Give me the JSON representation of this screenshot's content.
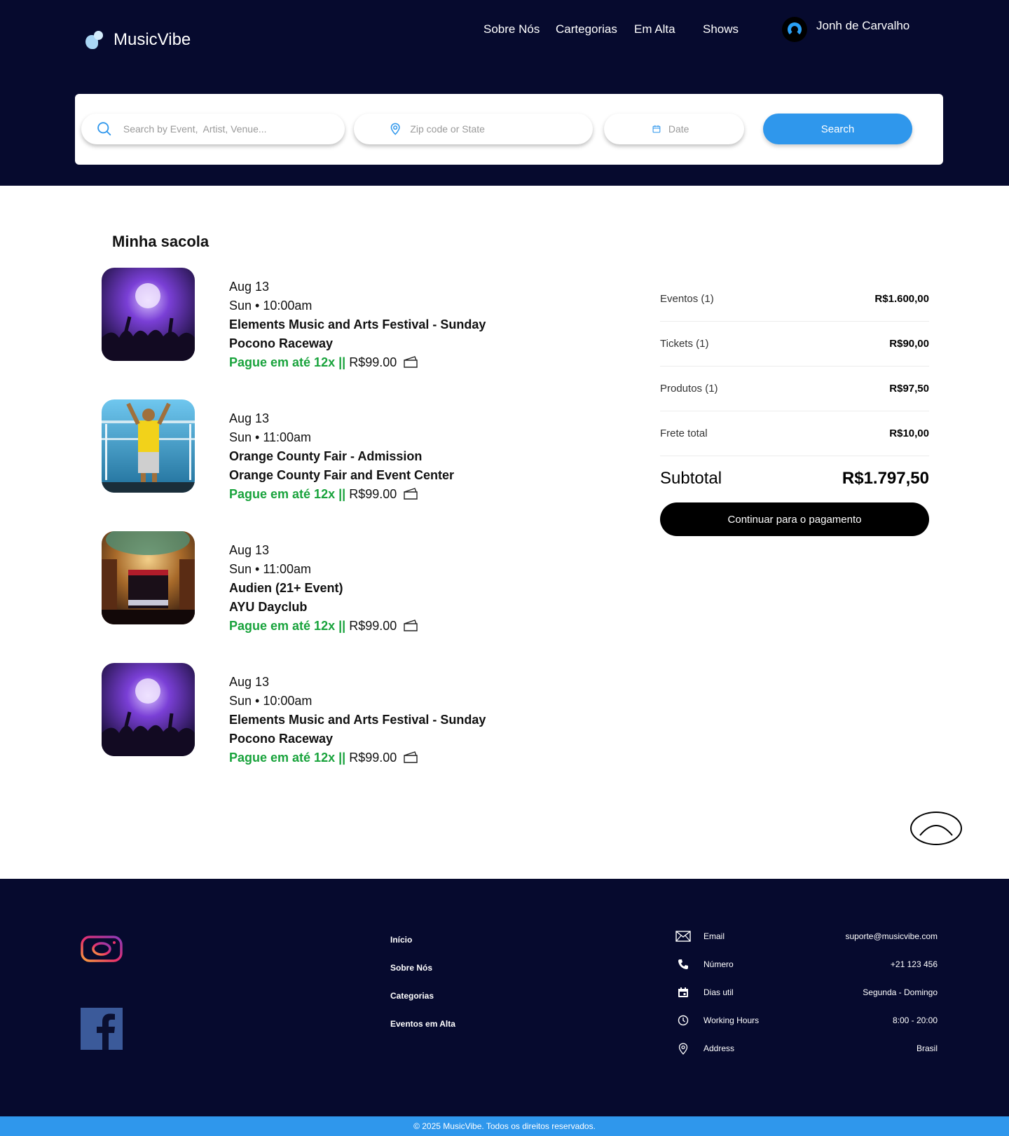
{
  "brand": {
    "name": "MusicVibe"
  },
  "nav": {
    "items": [
      {
        "label": "Sobre Nós"
      },
      {
        "label": "Cartegorias"
      },
      {
        "label": "Em Alta"
      },
      {
        "label": "Shows"
      }
    ],
    "user_name": "Jonh de Carvalho"
  },
  "search": {
    "query_placeholder": "Search by Event,  Artist, Venue...",
    "location_placeholder": "Zip code or State",
    "date_placeholder": "Date",
    "button_label": "Search"
  },
  "bag": {
    "title": "Minha sacola",
    "items": [
      {
        "date": "Aug 13",
        "time": "Sun • 10:00am",
        "event": "Elements Music and Arts Festival - Sunday",
        "venue": "Pocono Raceway",
        "installments": "Pague em até 12x",
        "separator": "||",
        "price": "R$99.00",
        "image": "concert-crowd-purple"
      },
      {
        "date": "Aug 13",
        "time": "Sun • 11:00am",
        "event": "Orange County Fair - Admission",
        "venue": "Orange County Fair and Event Center",
        "installments": "Pague em até 12x",
        "separator": "||",
        "price": "R$99.00",
        "image": "performer-stage-blue"
      },
      {
        "date": "Aug 13",
        "time": "Sun • 11:00am",
        "event": "Audien (21+ Event)",
        "venue": "AYU Dayclub",
        "installments": "Pague em até 12x",
        "separator": "||",
        "price": "R$99.00",
        "image": "theater-hall"
      },
      {
        "date": "Aug 13",
        "time": "Sun • 10:00am",
        "event": "Elements Music and Arts Festival - Sunday",
        "venue": "Pocono Raceway",
        "installments": "Pague em até 12x",
        "separator": "||",
        "price": "R$99.00",
        "image": "concert-crowd-purple"
      }
    ]
  },
  "summary": {
    "rows": [
      {
        "label": "Eventos (1)",
        "value": "R$1.600,00"
      },
      {
        "label": "Tickets (1)",
        "value": "R$90,00"
      },
      {
        "label": "Produtos (1)",
        "value": "R$97,50"
      },
      {
        "label": "Frete total",
        "value": "R$10,00"
      }
    ],
    "subtotal_label": "Subtotal",
    "subtotal_value": "R$1.797,50",
    "pay_button": "Continuar para o pagamento"
  },
  "footer": {
    "links": [
      {
        "label": "Início"
      },
      {
        "label": "Sobre Nós"
      },
      {
        "label": "Categorias"
      },
      {
        "label": "Eventos em Alta"
      }
    ],
    "contacts": [
      {
        "icon": "mail-icon",
        "label": "Email",
        "value": "suporte@musicvibe.com"
      },
      {
        "icon": "phone-icon",
        "label": "Número",
        "value": "+21 123 456"
      },
      {
        "icon": "calendar-icon",
        "label": "Dias util",
        "value": "Segunda - Domingo"
      },
      {
        "icon": "clock-icon",
        "label": "Working Hours",
        "value": "8:00 - 20:00"
      },
      {
        "icon": "location-icon",
        "label": "Address",
        "value": "Brasil"
      }
    ],
    "copyright": "© 2025 MusicVibe. Todos os direitos reservados."
  },
  "colors": {
    "header_bg": "#060a2e",
    "accent_blue": "#2f97ec",
    "installment_green": "#19a33c"
  }
}
